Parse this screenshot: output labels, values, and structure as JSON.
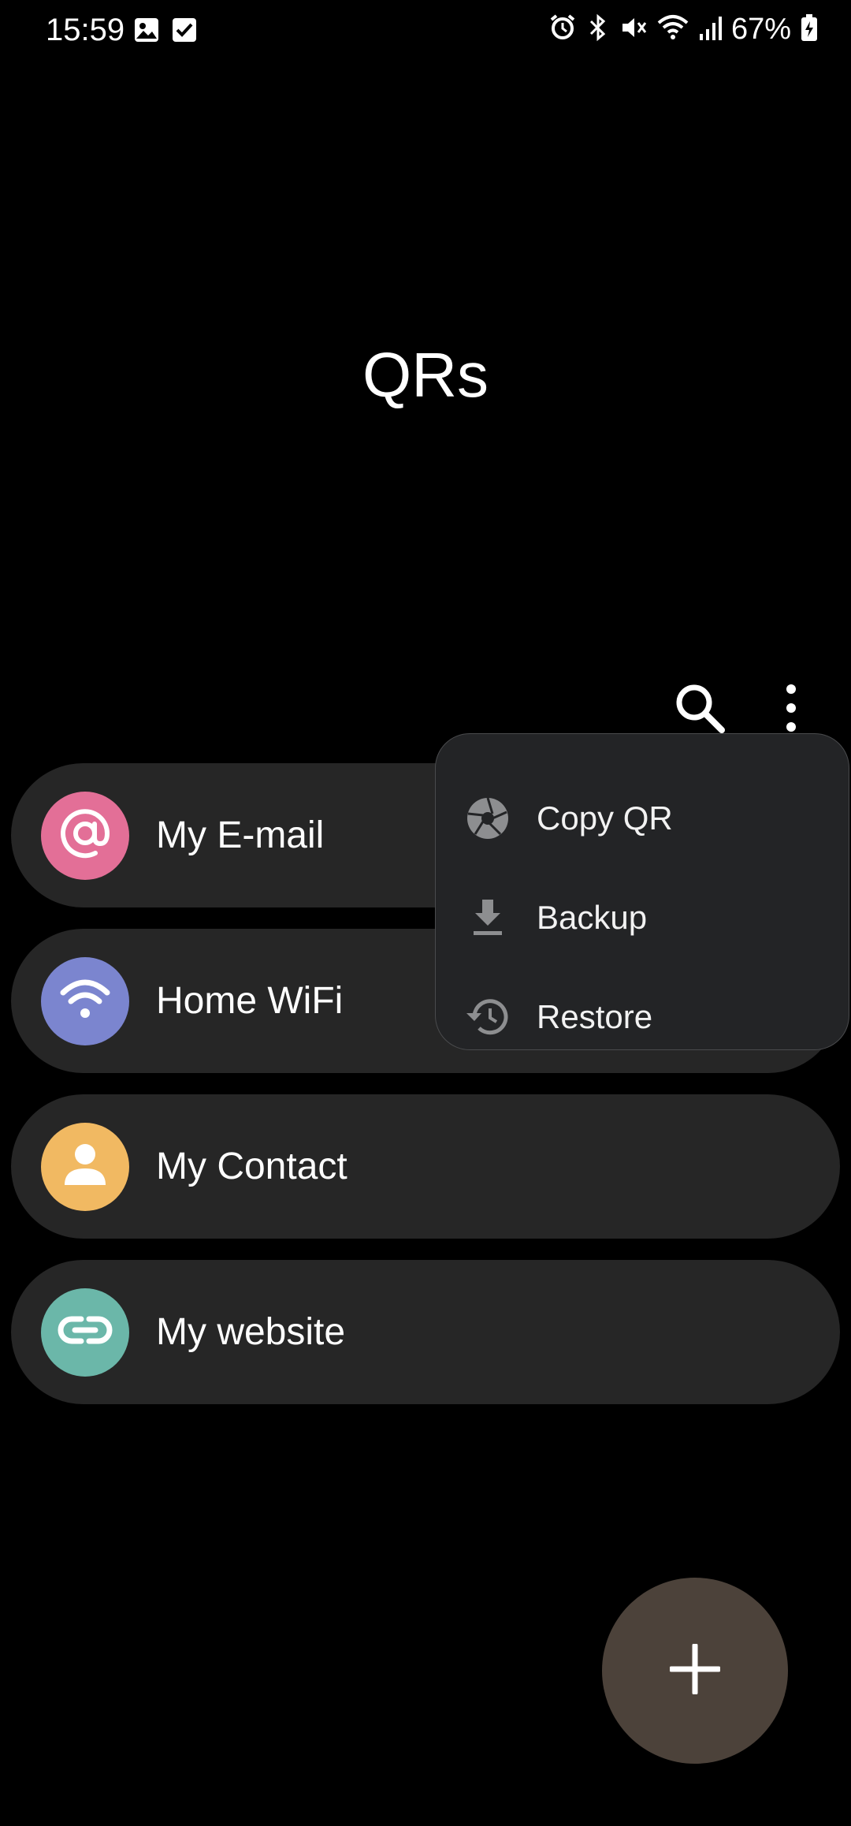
{
  "status_bar": {
    "time": "15:59",
    "battery": "67%",
    "left_icons": [
      "gallery-icon",
      "checkbox-icon"
    ],
    "right_icons": [
      "alarm-icon",
      "bluetooth-icon",
      "mute-icon",
      "wifi-icon",
      "signal-icon",
      "battery-icon"
    ]
  },
  "header": {
    "title": "QRs"
  },
  "toolbar": {
    "icons": [
      "search-icon",
      "more-options-icon"
    ]
  },
  "qr_items": [
    {
      "label": "My E-mail",
      "icon": "at-sign-icon",
      "color": "#e36f97"
    },
    {
      "label": "Home WiFi",
      "icon": "wifi-icon",
      "color": "#7b85cf"
    },
    {
      "label": "My Contact",
      "icon": "person-icon",
      "color": "#f1b962"
    },
    {
      "label": "My website",
      "icon": "link-icon",
      "color": "#6bb7a9"
    }
  ],
  "menu": {
    "items": [
      {
        "label": "Copy QR",
        "icon": "aperture-icon"
      },
      {
        "label": "Backup",
        "icon": "download-icon"
      },
      {
        "label": "Restore",
        "icon": "history-icon"
      }
    ]
  },
  "fab": {
    "icon": "plus-icon",
    "color": "#4c423a"
  }
}
